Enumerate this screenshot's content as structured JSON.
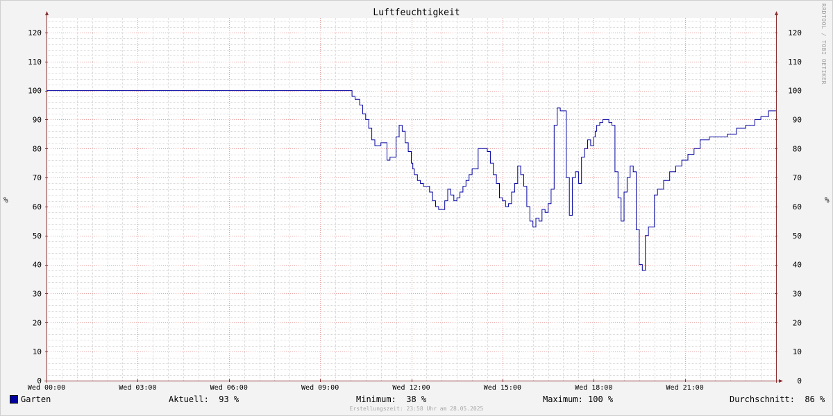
{
  "chart_data": {
    "type": "line",
    "title": "Luftfeuchtigkeit",
    "ylabel": "%",
    "ylim": [
      0,
      125
    ],
    "y_ticks": [
      0,
      10,
      20,
      30,
      40,
      50,
      60,
      70,
      80,
      90,
      100,
      110,
      120
    ],
    "x_range_hours": [
      0,
      24
    ],
    "x_tick_labels": [
      "Wed 00:00",
      "Wed 03:00",
      "Wed 06:00",
      "Wed 09:00",
      "Wed 12:00",
      "Wed 15:00",
      "Wed 18:00",
      "Wed 21:00"
    ],
    "x_tick_hours": [
      0,
      3,
      6,
      9,
      12,
      15,
      18,
      21
    ],
    "grid": true,
    "series": [
      {
        "name": "Garten",
        "color": "#0000a0",
        "x_hours": [
          0,
          10.0,
          10.05,
          10.15,
          10.3,
          10.4,
          10.5,
          10.6,
          10.7,
          10.8,
          10.9,
          11.0,
          11.1,
          11.2,
          11.3,
          11.5,
          11.6,
          11.7,
          11.8,
          11.9,
          12.0,
          12.05,
          12.1,
          12.2,
          12.3,
          12.4,
          12.5,
          12.6,
          12.7,
          12.8,
          12.9,
          13.0,
          13.1,
          13.2,
          13.3,
          13.4,
          13.5,
          13.6,
          13.7,
          13.8,
          13.9,
          14.0,
          14.2,
          14.4,
          14.5,
          14.6,
          14.7,
          14.8,
          14.9,
          15.0,
          15.1,
          15.2,
          15.3,
          15.4,
          15.5,
          15.6,
          15.7,
          15.8,
          15.9,
          16.0,
          16.1,
          16.2,
          16.3,
          16.4,
          16.5,
          16.6,
          16.7,
          16.8,
          16.9,
          17.0,
          17.1,
          17.2,
          17.3,
          17.4,
          17.5,
          17.6,
          17.7,
          17.8,
          17.9,
          18.0,
          18.05,
          18.1,
          18.2,
          18.3,
          18.4,
          18.5,
          18.6,
          18.7,
          18.8,
          18.9,
          19.0,
          19.1,
          19.2,
          19.3,
          19.4,
          19.5,
          19.6,
          19.7,
          19.8,
          19.9,
          20.0,
          20.1,
          20.3,
          20.5,
          20.7,
          20.9,
          21.1,
          21.3,
          21.5,
          21.8,
          22.1,
          22.4,
          22.7,
          23.0,
          23.3,
          23.5,
          23.75,
          24
        ],
        "values": [
          100,
          100,
          98,
          97,
          95,
          92,
          90,
          87,
          83,
          81,
          81,
          82,
          82,
          76,
          77,
          84,
          88,
          86,
          82,
          79,
          75,
          73,
          71,
          69,
          68,
          67,
          67,
          65,
          62,
          60,
          59,
          59,
          62,
          66,
          64,
          62,
          63,
          65,
          67,
          69,
          71,
          73,
          80,
          80,
          79,
          75,
          71,
          68,
          63,
          62,
          60,
          61,
          65,
          68,
          74,
          71,
          67,
          60,
          55,
          53,
          56,
          55,
          59,
          58,
          61,
          66,
          88,
          94,
          93,
          93,
          70,
          57,
          70,
          72,
          68,
          77,
          80,
          83,
          81,
          84,
          86,
          88,
          89,
          90,
          90,
          89,
          88,
          72,
          63,
          55,
          65,
          70,
          74,
          72,
          52,
          40,
          38,
          50,
          53,
          53,
          64,
          66,
          69,
          72,
          74,
          76,
          78,
          80,
          83,
          84,
          84,
          85,
          87,
          88,
          90,
          91,
          93,
          93
        ]
      }
    ]
  },
  "legend": {
    "series_name": "Garten",
    "current": "Aktuell:  93 %",
    "minimum": "Minimum:  38 %",
    "maximum": "Maximum: 100 %",
    "average": "Durchschnitt:  86 %"
  },
  "footer": "Erstellungszeit: 23:58 Uhr am 28.05.2025",
  "watermark": "RRDTOOL / TOBI OETIKER",
  "colors": {
    "background": "#f3f3f3",
    "canvas": "#ffffff",
    "major_grid": "#e8a0a0",
    "minor_grid": "#d8d8d8",
    "axis": "#8a3030",
    "line": "#0000a0"
  }
}
